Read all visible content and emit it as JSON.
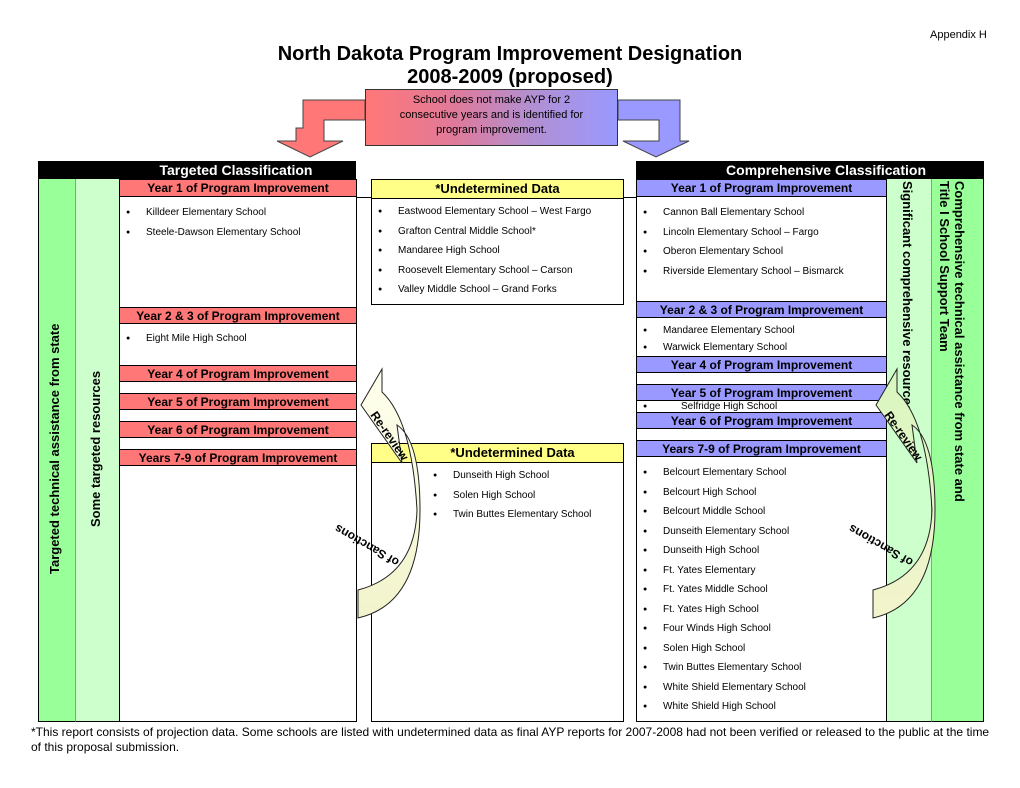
{
  "appendix_label": "Appendix H",
  "title": {
    "line1": "North Dakota Program Improvement Designation",
    "line2": "2008-2009 (proposed)"
  },
  "entry_box": {
    "line1": "School does not make AYP for 2",
    "line2": "consecutive years and is identified for",
    "line3": "program improvement."
  },
  "colors": {
    "targeted_header": "#ff7777",
    "comprehensive_header": "#9999ff",
    "undetermined_header": "#ffff88",
    "support_dark_green": "#99ff99",
    "support_light_green": "#ccffcc",
    "band": "#000000"
  },
  "targeted": {
    "title": "Targeted Classification",
    "side_outer": "Targeted technical assistance from state",
    "side_inner": "Some targeted resources",
    "sections": [
      {
        "header": "Year 1 of Program Improvement",
        "schools": [
          "Killdeer Elementary School",
          "Steele-Dawson Elementary School"
        ]
      },
      {
        "header": "Year 2 & 3 of Program Improvement",
        "schools": [
          "Eight Mile High School"
        ]
      },
      {
        "header": "Year 4 of Program Improvement",
        "schools": []
      },
      {
        "header": "Year 5 of Program Improvement",
        "schools": []
      },
      {
        "header": "Year 6 of Program Improvement",
        "schools": []
      },
      {
        "header": "Years 7-9 of Program Improvement",
        "schools": []
      }
    ]
  },
  "undetermined": [
    {
      "header": "*Undetermined Data",
      "schools": [
        "Eastwood Elementary School – West Fargo",
        "Grafton Central Middle School*",
        "Mandaree High School",
        "Roosevelt Elementary School – Carson",
        "Valley Middle School – Grand Forks"
      ]
    },
    {
      "header": "*Undetermined Data",
      "schools": [
        "Dunseith High School",
        "Solen High School",
        "Twin Buttes Elementary School"
      ]
    }
  ],
  "comprehensive": {
    "title": "Comprehensive Classification",
    "side_inner": "Significant comprehensive resources",
    "side_outer_line1": "Comprehensive technical assistance from state and",
    "side_outer_line2": "Title I School Support Team",
    "sections": [
      {
        "header": "Year 1 of Program Improvement",
        "schools": [
          "Cannon Ball Elementary School",
          "Lincoln Elementary School – Fargo",
          "Oberon Elementary School",
          "Riverside Elementary School – Bismarck"
        ]
      },
      {
        "header": "Year 2 & 3 of Program Improvement",
        "schools": [
          "Mandaree Elementary School",
          "Warwick Elementary School"
        ]
      },
      {
        "header": "Year 4 of Program Improvement",
        "schools": []
      },
      {
        "header": "Year 5 of Program Improvement",
        "schools": [
          "Selfridge High School"
        ]
      },
      {
        "header": "Year 6 of Program Improvement",
        "schools": []
      },
      {
        "header": "Years 7-9 of Program Improvement",
        "schools": [
          "Belcourt Elementary School",
          "Belcourt High School",
          "Belcourt Middle School",
          "Dunseith Elementary School",
          "Dunseith High School",
          "Ft. Yates Elementary",
          "Ft. Yates Middle School",
          "Ft. Yates High School",
          "Four Winds High School",
          "Solen High School",
          "Twin Buttes Elementary School",
          "White Shield Elementary School",
          "White Shield High School"
        ]
      }
    ]
  },
  "rereview_arrow": {
    "top_label": "Re-review",
    "bottom_label": "of Sanctions"
  },
  "footnote": "*This report consists of projection data. Some schools are listed with undetermined data as final AYP reports for 2007-2008 had not been verified or released to the public at the time of this proposal submission."
}
